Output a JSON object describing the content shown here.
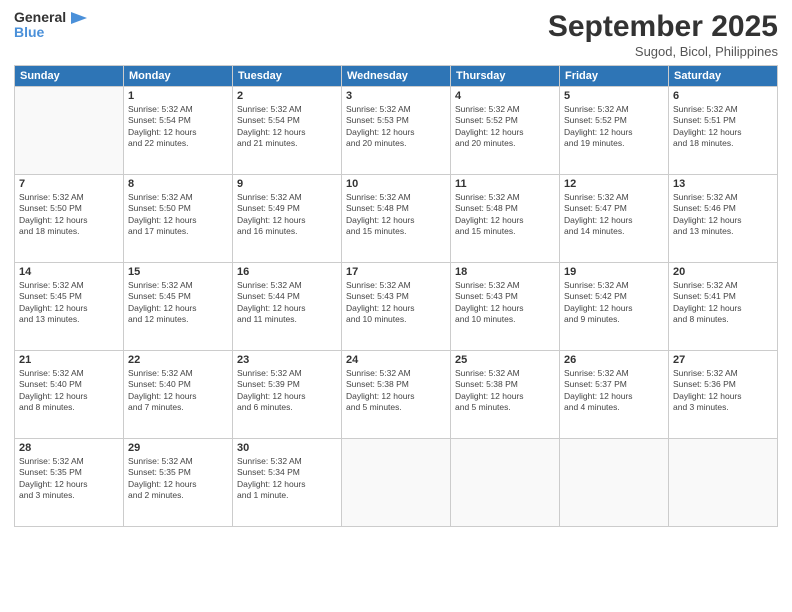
{
  "header": {
    "logo_line1": "General",
    "logo_line2": "Blue",
    "month_title": "September 2025",
    "subtitle": "Sugod, Bicol, Philippines"
  },
  "days_of_week": [
    "Sunday",
    "Monday",
    "Tuesday",
    "Wednesday",
    "Thursday",
    "Friday",
    "Saturday"
  ],
  "weeks": [
    [
      {
        "day": "",
        "info": ""
      },
      {
        "day": "1",
        "info": "Sunrise: 5:32 AM\nSunset: 5:54 PM\nDaylight: 12 hours\nand 22 minutes."
      },
      {
        "day": "2",
        "info": "Sunrise: 5:32 AM\nSunset: 5:54 PM\nDaylight: 12 hours\nand 21 minutes."
      },
      {
        "day": "3",
        "info": "Sunrise: 5:32 AM\nSunset: 5:53 PM\nDaylight: 12 hours\nand 20 minutes."
      },
      {
        "day": "4",
        "info": "Sunrise: 5:32 AM\nSunset: 5:52 PM\nDaylight: 12 hours\nand 20 minutes."
      },
      {
        "day": "5",
        "info": "Sunrise: 5:32 AM\nSunset: 5:52 PM\nDaylight: 12 hours\nand 19 minutes."
      },
      {
        "day": "6",
        "info": "Sunrise: 5:32 AM\nSunset: 5:51 PM\nDaylight: 12 hours\nand 18 minutes."
      }
    ],
    [
      {
        "day": "7",
        "info": "Sunrise: 5:32 AM\nSunset: 5:50 PM\nDaylight: 12 hours\nand 18 minutes."
      },
      {
        "day": "8",
        "info": "Sunrise: 5:32 AM\nSunset: 5:50 PM\nDaylight: 12 hours\nand 17 minutes."
      },
      {
        "day": "9",
        "info": "Sunrise: 5:32 AM\nSunset: 5:49 PM\nDaylight: 12 hours\nand 16 minutes."
      },
      {
        "day": "10",
        "info": "Sunrise: 5:32 AM\nSunset: 5:48 PM\nDaylight: 12 hours\nand 15 minutes."
      },
      {
        "day": "11",
        "info": "Sunrise: 5:32 AM\nSunset: 5:48 PM\nDaylight: 12 hours\nand 15 minutes."
      },
      {
        "day": "12",
        "info": "Sunrise: 5:32 AM\nSunset: 5:47 PM\nDaylight: 12 hours\nand 14 minutes."
      },
      {
        "day": "13",
        "info": "Sunrise: 5:32 AM\nSunset: 5:46 PM\nDaylight: 12 hours\nand 13 minutes."
      }
    ],
    [
      {
        "day": "14",
        "info": "Sunrise: 5:32 AM\nSunset: 5:45 PM\nDaylight: 12 hours\nand 13 minutes."
      },
      {
        "day": "15",
        "info": "Sunrise: 5:32 AM\nSunset: 5:45 PM\nDaylight: 12 hours\nand 12 minutes."
      },
      {
        "day": "16",
        "info": "Sunrise: 5:32 AM\nSunset: 5:44 PM\nDaylight: 12 hours\nand 11 minutes."
      },
      {
        "day": "17",
        "info": "Sunrise: 5:32 AM\nSunset: 5:43 PM\nDaylight: 12 hours\nand 10 minutes."
      },
      {
        "day": "18",
        "info": "Sunrise: 5:32 AM\nSunset: 5:43 PM\nDaylight: 12 hours\nand 10 minutes."
      },
      {
        "day": "19",
        "info": "Sunrise: 5:32 AM\nSunset: 5:42 PM\nDaylight: 12 hours\nand 9 minutes."
      },
      {
        "day": "20",
        "info": "Sunrise: 5:32 AM\nSunset: 5:41 PM\nDaylight: 12 hours\nand 8 minutes."
      }
    ],
    [
      {
        "day": "21",
        "info": "Sunrise: 5:32 AM\nSunset: 5:40 PM\nDaylight: 12 hours\nand 8 minutes."
      },
      {
        "day": "22",
        "info": "Sunrise: 5:32 AM\nSunset: 5:40 PM\nDaylight: 12 hours\nand 7 minutes."
      },
      {
        "day": "23",
        "info": "Sunrise: 5:32 AM\nSunset: 5:39 PM\nDaylight: 12 hours\nand 6 minutes."
      },
      {
        "day": "24",
        "info": "Sunrise: 5:32 AM\nSunset: 5:38 PM\nDaylight: 12 hours\nand 5 minutes."
      },
      {
        "day": "25",
        "info": "Sunrise: 5:32 AM\nSunset: 5:38 PM\nDaylight: 12 hours\nand 5 minutes."
      },
      {
        "day": "26",
        "info": "Sunrise: 5:32 AM\nSunset: 5:37 PM\nDaylight: 12 hours\nand 4 minutes."
      },
      {
        "day": "27",
        "info": "Sunrise: 5:32 AM\nSunset: 5:36 PM\nDaylight: 12 hours\nand 3 minutes."
      }
    ],
    [
      {
        "day": "28",
        "info": "Sunrise: 5:32 AM\nSunset: 5:35 PM\nDaylight: 12 hours\nand 3 minutes."
      },
      {
        "day": "29",
        "info": "Sunrise: 5:32 AM\nSunset: 5:35 PM\nDaylight: 12 hours\nand 2 minutes."
      },
      {
        "day": "30",
        "info": "Sunrise: 5:32 AM\nSunset: 5:34 PM\nDaylight: 12 hours\nand 1 minute."
      },
      {
        "day": "",
        "info": ""
      },
      {
        "day": "",
        "info": ""
      },
      {
        "day": "",
        "info": ""
      },
      {
        "day": "",
        "info": ""
      }
    ]
  ]
}
